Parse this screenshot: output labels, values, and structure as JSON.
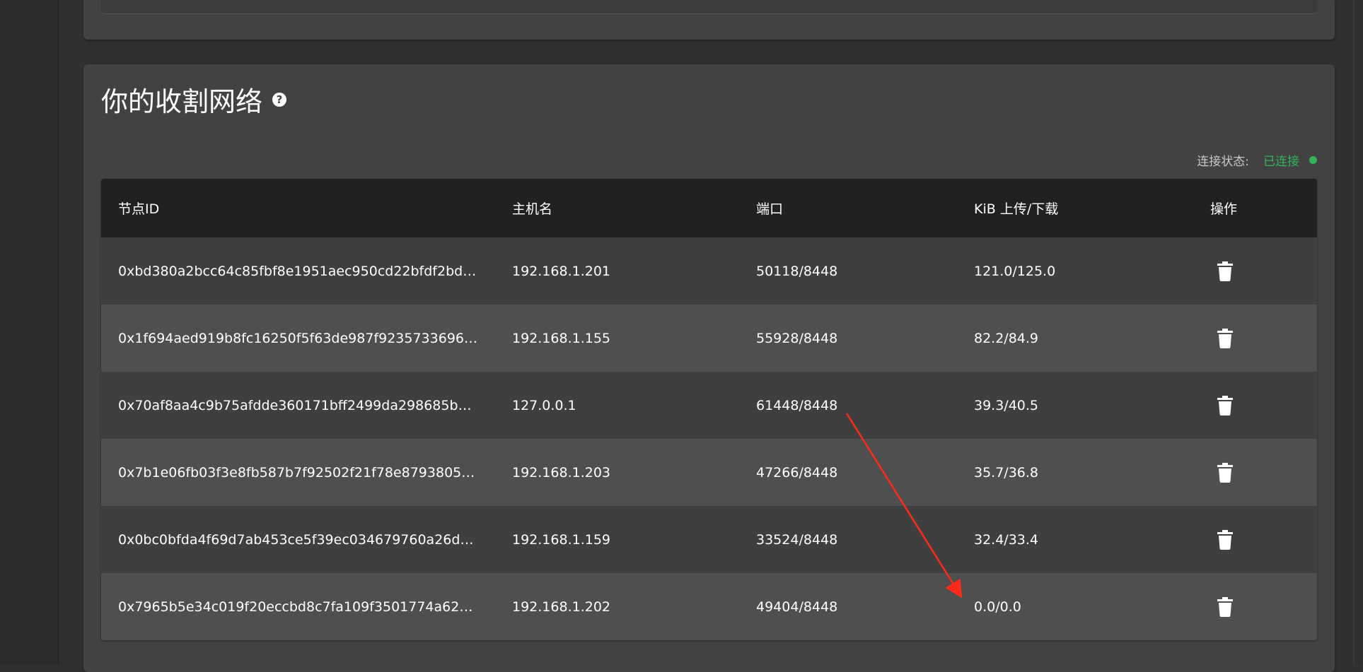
{
  "section": {
    "title": "你的收割网络",
    "help_glyph": "?"
  },
  "connection": {
    "label": "连接状态:",
    "value": "已连接",
    "color": "#33b35a"
  },
  "table": {
    "columns": [
      "节点ID",
      "主机名",
      "端口",
      "KiB 上传/下载",
      "操作"
    ],
    "rows": [
      {
        "node_id": "0xbd380a2bcc64c85fbf8e1951aec950cd22bfdf2bd…",
        "host": "192.168.1.201",
        "port": "50118/8448",
        "traffic": "121.0/125.0"
      },
      {
        "node_id": "0x1f694aed919b8fc16250f5f63de987f9235733696…",
        "host": "192.168.1.155",
        "port": "55928/8448",
        "traffic": "82.2/84.9"
      },
      {
        "node_id": "0x70af8aa4c9b75afdde360171bff2499da298685be…",
        "host": "127.0.0.1",
        "port": "61448/8448",
        "traffic": "39.3/40.5"
      },
      {
        "node_id": "0x7b1e06fb03f3e8fb587b7f92502f21f78e8793805…",
        "host": "192.168.1.203",
        "port": "47266/8448",
        "traffic": "35.7/36.8"
      },
      {
        "node_id": "0x0bc0bfda4f69d7ab453ce5f39ec034679760a26d…",
        "host": "192.168.1.159",
        "port": "33524/8448",
        "traffic": "32.4/33.4"
      },
      {
        "node_id": "0x7965b5e34c019f20eccbd8c7fa109f3501774a62…",
        "host": "192.168.1.202",
        "port": "49404/8448",
        "traffic": "0.0/0.0"
      }
    ],
    "action_icon": "trash-icon"
  },
  "annotation": {
    "arrow_color": "#ff2a1a"
  }
}
